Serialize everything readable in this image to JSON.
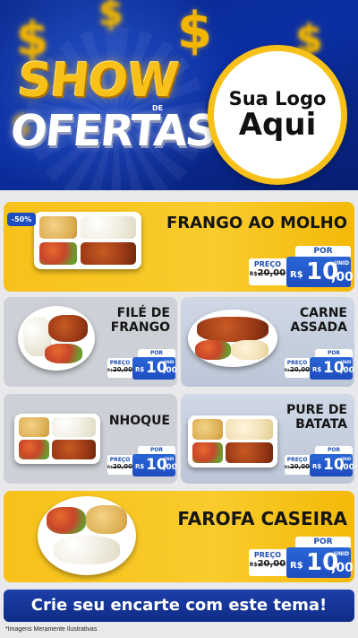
{
  "header": {
    "logo_line1": "SHOW",
    "logo_de": "DE",
    "logo_line2": "OFERTAS",
    "placeholder_line1": "Sua Logo",
    "placeholder_line2": "Aqui"
  },
  "discount_badge": "-50%",
  "products": [
    {
      "name_line1": "FRANGO AO MOLHO",
      "name_line2": "",
      "preco_label": "PREÇO",
      "old_prefix": "R$",
      "old_price": "20,00",
      "por_label": "POR",
      "currency": "R$",
      "price_int": "10",
      "price_dec": ",00",
      "unit": "UNID"
    },
    {
      "name_line1": "FILÉ DE",
      "name_line2": "FRANGO",
      "preco_label": "PREÇO",
      "old_prefix": "R$",
      "old_price": "20,00",
      "por_label": "POR",
      "currency": "R$",
      "price_int": "10",
      "price_dec": ",00",
      "unit": "UNID"
    },
    {
      "name_line1": "CARNE",
      "name_line2": "ASSADA",
      "preco_label": "PREÇO",
      "old_prefix": "R$",
      "old_price": "20,00",
      "por_label": "POR",
      "currency": "R$",
      "price_int": "10",
      "price_dec": ",00",
      "unit": "UNID"
    },
    {
      "name_line1": "NHOQUE",
      "name_line2": "",
      "preco_label": "PREÇO",
      "old_prefix": "R$",
      "old_price": "20,00",
      "por_label": "POR",
      "currency": "R$",
      "price_int": "10",
      "price_dec": ",00",
      "unit": "UNID"
    },
    {
      "name_line1": "PURE DE",
      "name_line2": "BATATA",
      "preco_label": "PREÇO",
      "old_prefix": "R$",
      "old_price": "20,00",
      "por_label": "POR",
      "currency": "R$",
      "price_int": "10",
      "price_dec": ",00",
      "unit": "UNID"
    },
    {
      "name_line1": "FAROFA CASEIRA",
      "name_line2": "",
      "preco_label": "PREÇO",
      "old_prefix": "R$",
      "old_price": "20,00",
      "por_label": "POR",
      "currency": "R$",
      "price_int": "10",
      "price_dec": ",00",
      "unit": "UNID"
    }
  ],
  "cta_text": "Crie seu encarte com este tema!",
  "disclaimer": "*Imagens Meramente Ilustrativas",
  "colors": {
    "brand_blue": "#1d4dbf",
    "brand_yellow": "#f7c11a",
    "card_gray": "#cdd0d6"
  },
  "icons": [
    "dollar-sign-icon"
  ]
}
